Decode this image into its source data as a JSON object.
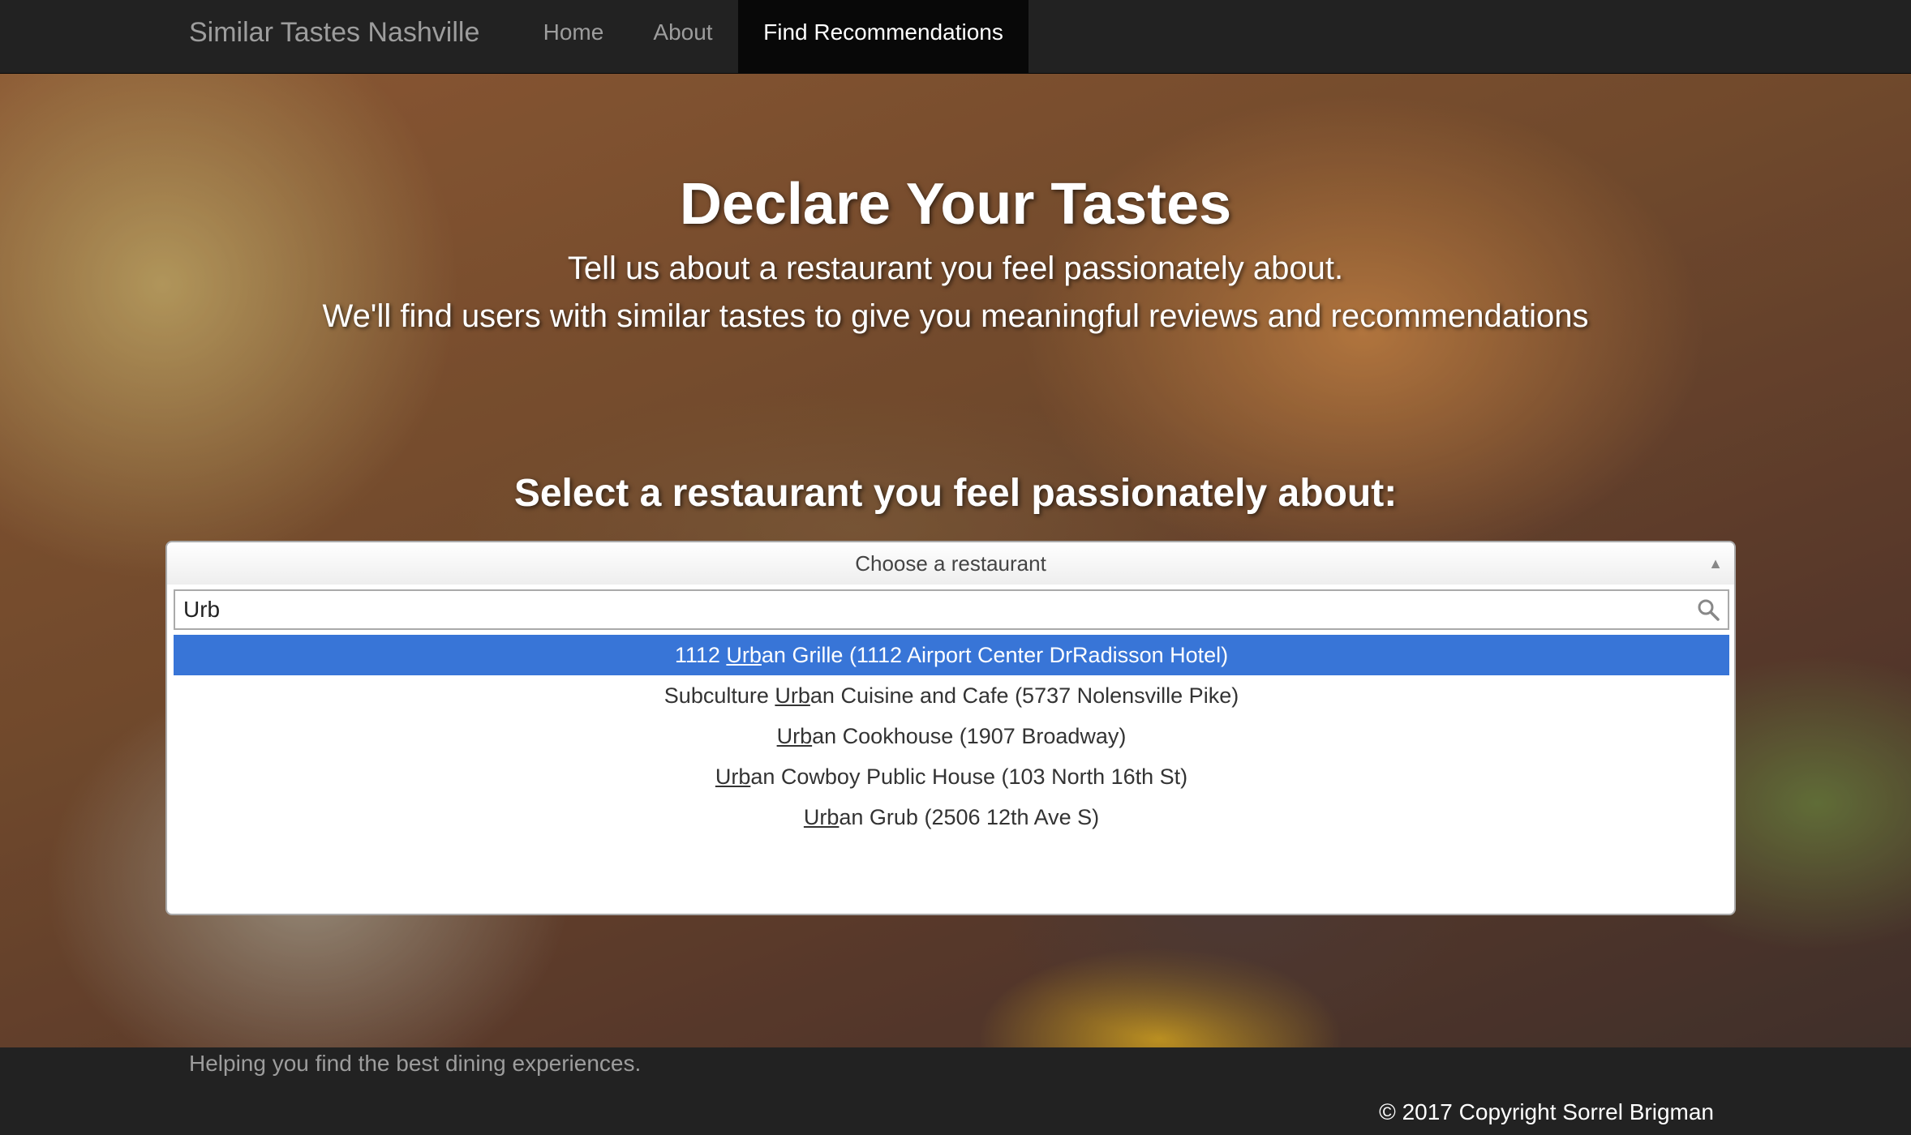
{
  "navbar": {
    "brand": "Similar Tastes Nashville",
    "links": [
      {
        "label": "Home",
        "active": false
      },
      {
        "label": "About",
        "active": false
      },
      {
        "label": "Find Recommendations",
        "active": true
      }
    ]
  },
  "hero": {
    "title": "Declare Your Tastes",
    "subtitle_line1": "Tell us about a restaurant you feel passionately about.",
    "subtitle_line2": "We'll find users with similar tastes to give you meaningful reviews and recommendations"
  },
  "selector": {
    "heading": "Select a restaurant you feel passionately about:",
    "placeholder": "Choose a restaurant",
    "search_value": "Urb",
    "options": [
      {
        "before": "1112 ",
        "match": "Urb",
        "after": "an Grille (1112 Airport Center DrRadisson Hotel)",
        "highlighted": true
      },
      {
        "before": "Subculture ",
        "match": "Urb",
        "after": "an Cuisine and Cafe (5737 Nolensville Pike)",
        "highlighted": false
      },
      {
        "before": "",
        "match": "Urb",
        "after": "an Cookhouse (1907 Broadway)",
        "highlighted": false
      },
      {
        "before": "",
        "match": "Urb",
        "after": "an Cowboy Public House (103 North 16th St)",
        "highlighted": false
      },
      {
        "before": "",
        "match": "Urb",
        "after": "an Grub (2506 12th Ave S)",
        "highlighted": false
      }
    ]
  },
  "footer": {
    "tagline": "Helping you find the best dining experiences.",
    "copyright": "© 2017 Copyright Sorrel Brigman"
  },
  "colors": {
    "navbar_bg": "#222222",
    "highlight": "#3875d7"
  }
}
